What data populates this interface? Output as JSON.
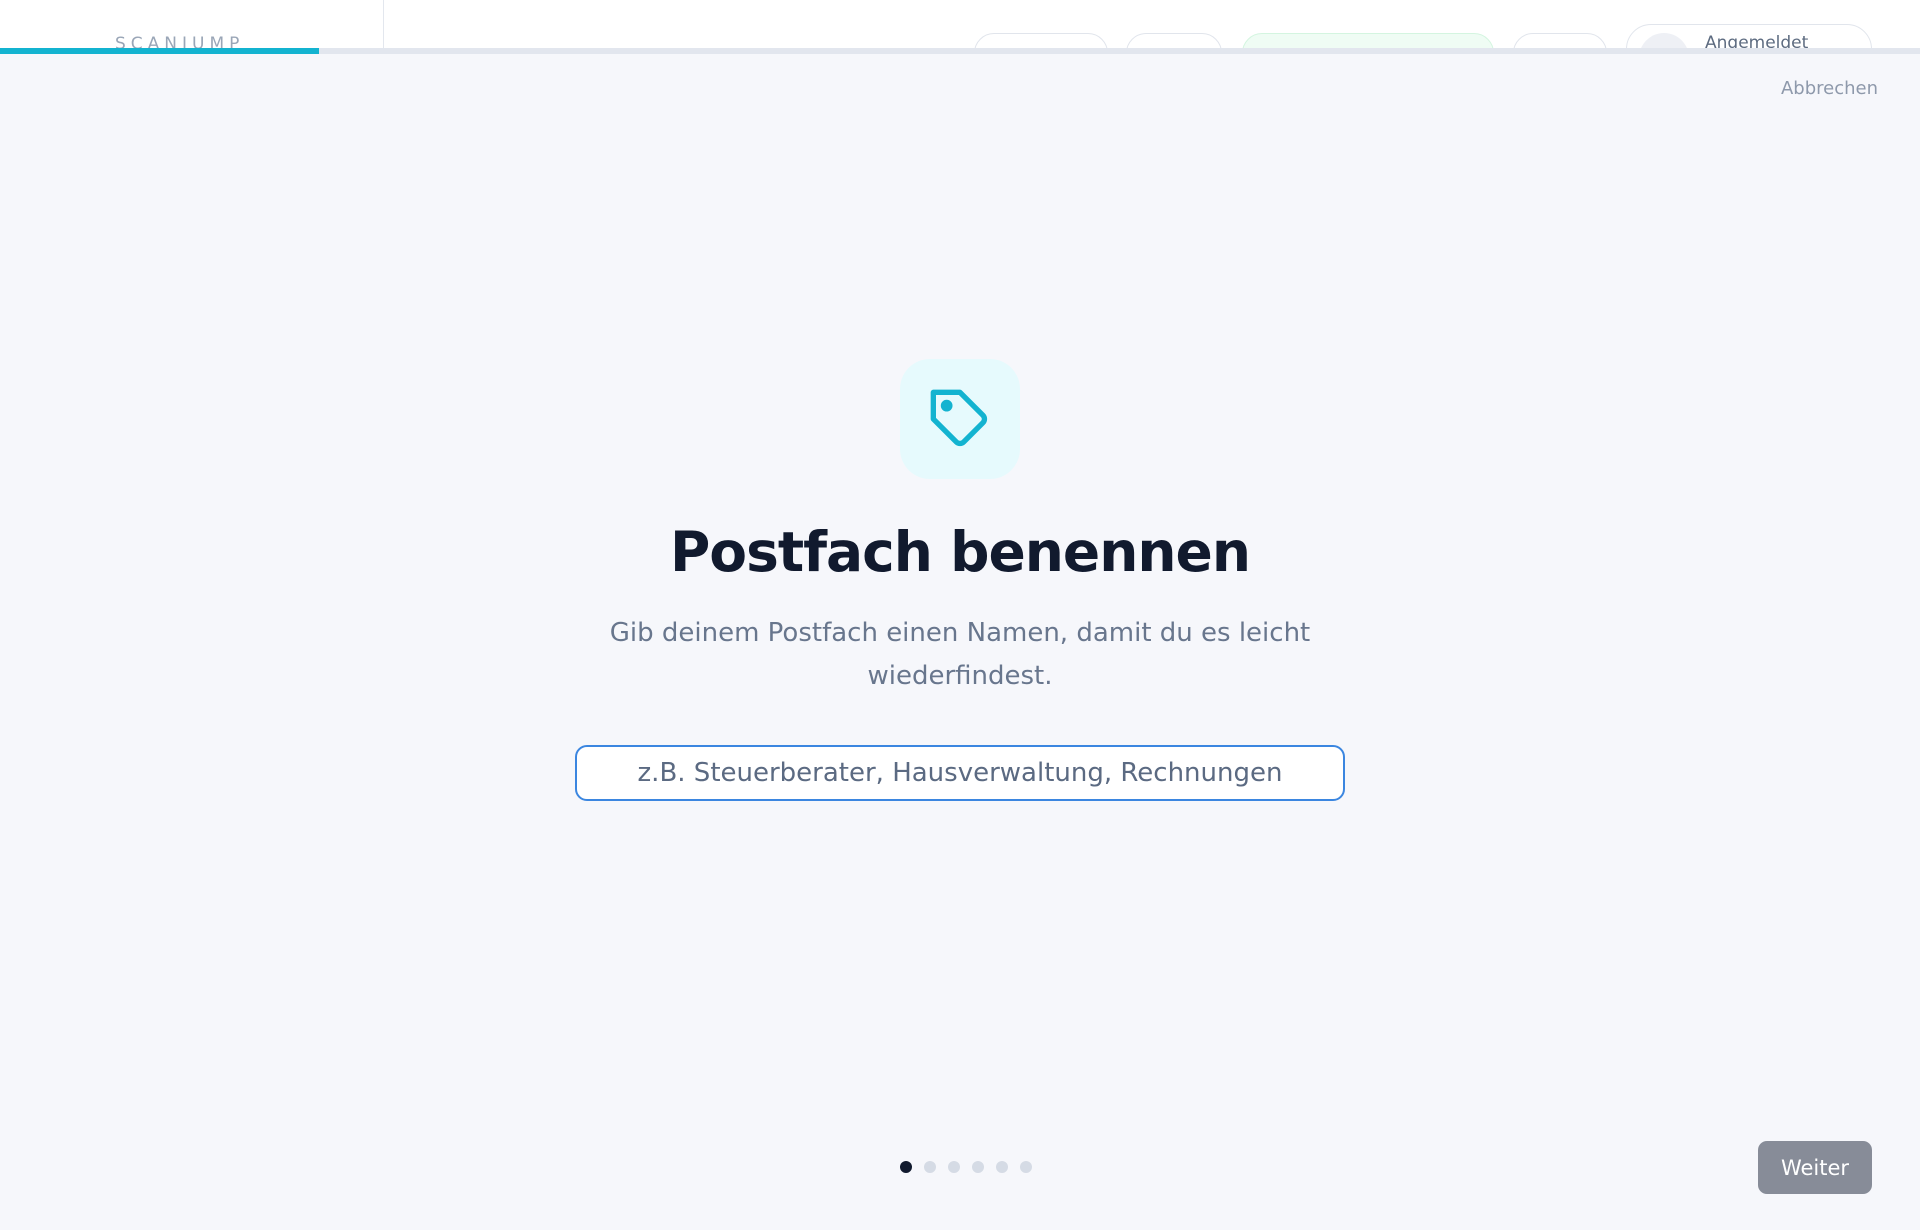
{
  "header": {
    "logo_text": "SCANJUMP",
    "user_label": "Angemeldet"
  },
  "progress": {
    "fraction": 0.166
  },
  "wizard": {
    "cancel_label": "Abbrechen",
    "icon": "tag-icon",
    "title": "Postfach benennen",
    "subtitle": "Gib deinem Postfach einen Namen, damit du es leicht wiederfindest.",
    "input": {
      "value": "",
      "placeholder": "z.B. Steuerberater, Hausverwaltung, Rechnungen"
    },
    "steps": {
      "total": 6,
      "current": 1
    },
    "next_label": "Weiter"
  },
  "colors": {
    "accent": "#13b3d0",
    "icon_bg": "#e6fafd",
    "input_border": "#3b86e0",
    "title": "#111a2e",
    "subtitle": "#68768d",
    "button_disabled": "#878c98",
    "background": "#f6f7fb"
  }
}
